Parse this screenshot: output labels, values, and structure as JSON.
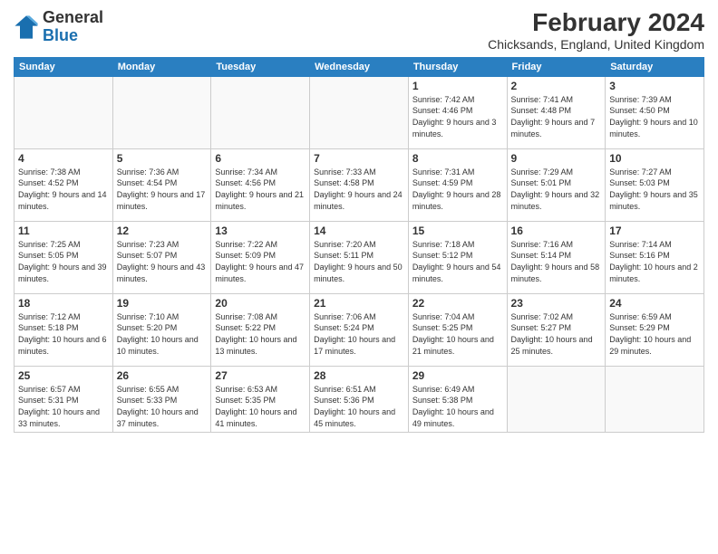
{
  "header": {
    "logo_general": "General",
    "logo_blue": "Blue",
    "month_year": "February 2024",
    "location": "Chicksands, England, United Kingdom"
  },
  "calendar": {
    "days_of_week": [
      "Sunday",
      "Monday",
      "Tuesday",
      "Wednesday",
      "Thursday",
      "Friday",
      "Saturday"
    ],
    "weeks": [
      [
        {
          "day": "",
          "info": ""
        },
        {
          "day": "",
          "info": ""
        },
        {
          "day": "",
          "info": ""
        },
        {
          "day": "",
          "info": ""
        },
        {
          "day": "1",
          "info": "Sunrise: 7:42 AM\nSunset: 4:46 PM\nDaylight: 9 hours and 3 minutes."
        },
        {
          "day": "2",
          "info": "Sunrise: 7:41 AM\nSunset: 4:48 PM\nDaylight: 9 hours and 7 minutes."
        },
        {
          "day": "3",
          "info": "Sunrise: 7:39 AM\nSunset: 4:50 PM\nDaylight: 9 hours and 10 minutes."
        }
      ],
      [
        {
          "day": "4",
          "info": "Sunrise: 7:38 AM\nSunset: 4:52 PM\nDaylight: 9 hours and 14 minutes."
        },
        {
          "day": "5",
          "info": "Sunrise: 7:36 AM\nSunset: 4:54 PM\nDaylight: 9 hours and 17 minutes."
        },
        {
          "day": "6",
          "info": "Sunrise: 7:34 AM\nSunset: 4:56 PM\nDaylight: 9 hours and 21 minutes."
        },
        {
          "day": "7",
          "info": "Sunrise: 7:33 AM\nSunset: 4:58 PM\nDaylight: 9 hours and 24 minutes."
        },
        {
          "day": "8",
          "info": "Sunrise: 7:31 AM\nSunset: 4:59 PM\nDaylight: 9 hours and 28 minutes."
        },
        {
          "day": "9",
          "info": "Sunrise: 7:29 AM\nSunset: 5:01 PM\nDaylight: 9 hours and 32 minutes."
        },
        {
          "day": "10",
          "info": "Sunrise: 7:27 AM\nSunset: 5:03 PM\nDaylight: 9 hours and 35 minutes."
        }
      ],
      [
        {
          "day": "11",
          "info": "Sunrise: 7:25 AM\nSunset: 5:05 PM\nDaylight: 9 hours and 39 minutes."
        },
        {
          "day": "12",
          "info": "Sunrise: 7:23 AM\nSunset: 5:07 PM\nDaylight: 9 hours and 43 minutes."
        },
        {
          "day": "13",
          "info": "Sunrise: 7:22 AM\nSunset: 5:09 PM\nDaylight: 9 hours and 47 minutes."
        },
        {
          "day": "14",
          "info": "Sunrise: 7:20 AM\nSunset: 5:11 PM\nDaylight: 9 hours and 50 minutes."
        },
        {
          "day": "15",
          "info": "Sunrise: 7:18 AM\nSunset: 5:12 PM\nDaylight: 9 hours and 54 minutes."
        },
        {
          "day": "16",
          "info": "Sunrise: 7:16 AM\nSunset: 5:14 PM\nDaylight: 9 hours and 58 minutes."
        },
        {
          "day": "17",
          "info": "Sunrise: 7:14 AM\nSunset: 5:16 PM\nDaylight: 10 hours and 2 minutes."
        }
      ],
      [
        {
          "day": "18",
          "info": "Sunrise: 7:12 AM\nSunset: 5:18 PM\nDaylight: 10 hours and 6 minutes."
        },
        {
          "day": "19",
          "info": "Sunrise: 7:10 AM\nSunset: 5:20 PM\nDaylight: 10 hours and 10 minutes."
        },
        {
          "day": "20",
          "info": "Sunrise: 7:08 AM\nSunset: 5:22 PM\nDaylight: 10 hours and 13 minutes."
        },
        {
          "day": "21",
          "info": "Sunrise: 7:06 AM\nSunset: 5:24 PM\nDaylight: 10 hours and 17 minutes."
        },
        {
          "day": "22",
          "info": "Sunrise: 7:04 AM\nSunset: 5:25 PM\nDaylight: 10 hours and 21 minutes."
        },
        {
          "day": "23",
          "info": "Sunrise: 7:02 AM\nSunset: 5:27 PM\nDaylight: 10 hours and 25 minutes."
        },
        {
          "day": "24",
          "info": "Sunrise: 6:59 AM\nSunset: 5:29 PM\nDaylight: 10 hours and 29 minutes."
        }
      ],
      [
        {
          "day": "25",
          "info": "Sunrise: 6:57 AM\nSunset: 5:31 PM\nDaylight: 10 hours and 33 minutes."
        },
        {
          "day": "26",
          "info": "Sunrise: 6:55 AM\nSunset: 5:33 PM\nDaylight: 10 hours and 37 minutes."
        },
        {
          "day": "27",
          "info": "Sunrise: 6:53 AM\nSunset: 5:35 PM\nDaylight: 10 hours and 41 minutes."
        },
        {
          "day": "28",
          "info": "Sunrise: 6:51 AM\nSunset: 5:36 PM\nDaylight: 10 hours and 45 minutes."
        },
        {
          "day": "29",
          "info": "Sunrise: 6:49 AM\nSunset: 5:38 PM\nDaylight: 10 hours and 49 minutes."
        },
        {
          "day": "",
          "info": ""
        },
        {
          "day": "",
          "info": ""
        }
      ]
    ]
  }
}
